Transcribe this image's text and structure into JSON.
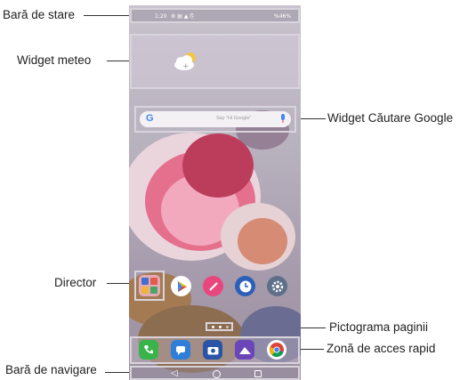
{
  "labels": {
    "status_bar": "Bară de stare",
    "weather_widget": "Widget meteo",
    "google_widget": "Widget Căutare Google",
    "folder": "Director",
    "page_icon": "Pictograma paginii",
    "quick_access": "Zonă de acces rapid",
    "nav_bar": "Bară de navigare"
  },
  "phone": {
    "status_time": "1:20",
    "status_battery": "%46%",
    "google_hint": "Say \"Hi Google\"",
    "google_letter": "G"
  },
  "icons": {
    "home_apps": [
      "folder-icon",
      "play-store-icon",
      "pen-icon",
      "clock-icon",
      "settings-icon"
    ],
    "dock_apps": [
      "phone-icon",
      "messages-icon",
      "camera-icon",
      "gallery-icon",
      "chrome-icon"
    ]
  }
}
